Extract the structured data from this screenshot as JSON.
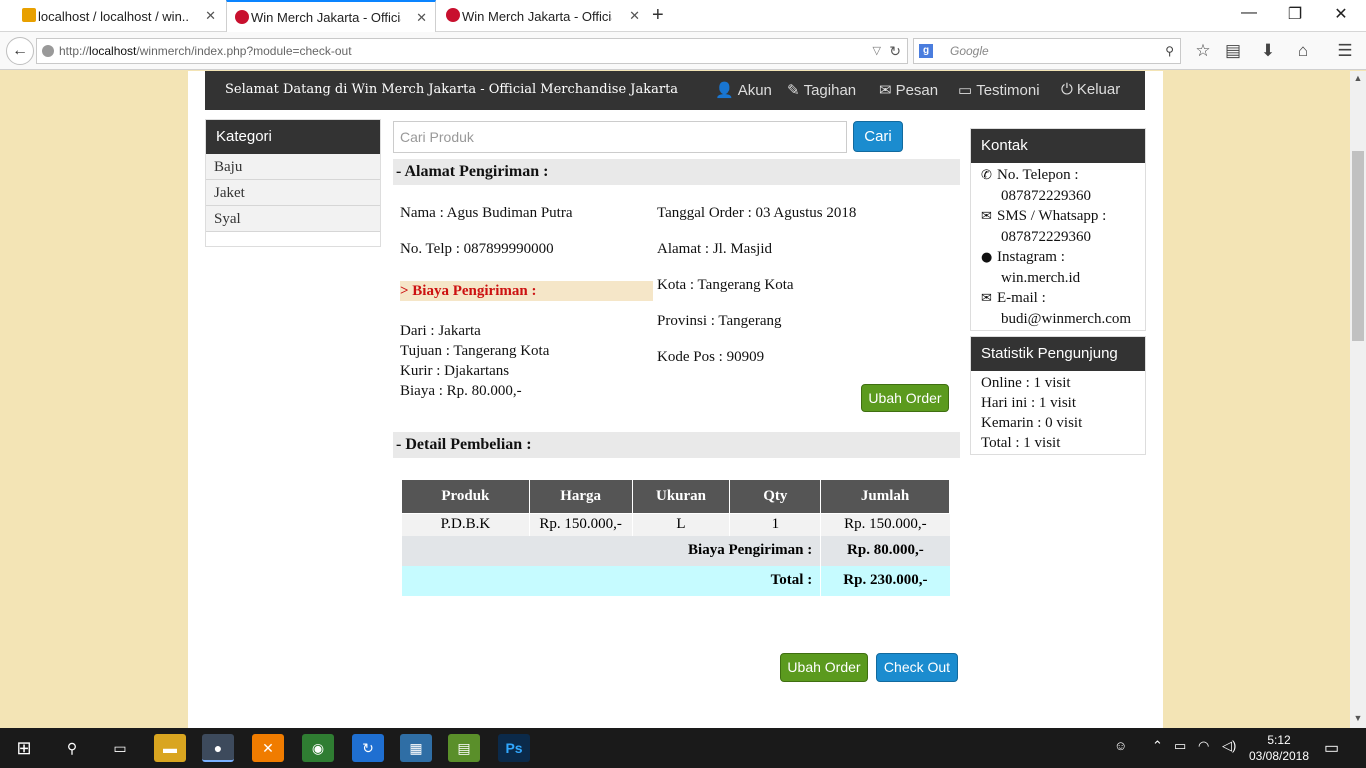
{
  "browser": {
    "tabs": [
      {
        "label": "localhost / localhost / win...",
        "active": false
      },
      {
        "label": "Win Merch Jakarta - Officia...",
        "active": true
      },
      {
        "label": "Win Merch Jakarta - Officia...",
        "active": false
      }
    ],
    "url_prefix": "http://",
    "url_host": "localhost",
    "url_path": "/winmerch/index.php?module=check-out",
    "search_placeholder": "Google"
  },
  "header": {
    "welcome": "Selamat Datang di Win Merch Jakarta - Official Merchandise Jakarta",
    "nav": [
      {
        "label": "Akun",
        "icon": "user-icon"
      },
      {
        "label": "Tagihan",
        "icon": "edit-icon"
      },
      {
        "label": "Pesan",
        "icon": "envelope-icon"
      },
      {
        "label": "Testimoni",
        "icon": "comment-icon"
      },
      {
        "label": "Keluar",
        "icon": "power-icon"
      }
    ]
  },
  "kategori": {
    "title": "Kategori",
    "items": [
      "Baju",
      "Jaket",
      "Syal"
    ]
  },
  "search": {
    "placeholder": "Cari Produk",
    "button": "Cari"
  },
  "alamat": {
    "title": "- Alamat Pengiriman :",
    "nama": "Nama : Agus Budiman Putra",
    "telp": "No. Telp : 087899990000",
    "tanggal": "Tanggal Order : 03 Agustus 2018",
    "alamat": "Alamat : Jl. Masjid",
    "kota": "Kota : Tangerang Kota",
    "provinsi": "Provinsi : Tangerang",
    "kodepos": "Kode Pos : 90909",
    "ubah_label": "Ubah Order"
  },
  "biaya": {
    "title": "> Biaya Pengiriman :",
    "dari": "Dari : Jakarta",
    "tujuan": "Tujuan : Tangerang Kota",
    "kurir": "Kurir : Djakartans",
    "biaya": "Biaya : Rp. 80.000,-"
  },
  "detail": {
    "title": "- Detail Pembelian :",
    "columns": [
      "Produk",
      "Harga",
      "Ukuran",
      "Qty",
      "Jumlah"
    ],
    "row": {
      "produk": "P.D.B.K",
      "harga": "Rp. 150.000,-",
      "ukuran": "L",
      "qty": "1",
      "jumlah": "Rp. 150.000,-"
    },
    "ship_label": "Biaya Pengiriman :",
    "ship_value": "Rp. 80.000,-",
    "total_label": "Total :",
    "total_value": "Rp. 230.000,-"
  },
  "actions": {
    "ubah_label": "Ubah Order",
    "checkout_label": "Check Out"
  },
  "kontak": {
    "title": "Kontak",
    "telepon_label": "No. Telepon :",
    "telepon": "087872229360",
    "sms_label": "SMS / Whatsapp :",
    "sms": "087872229360",
    "instagram_label": "Instagram :",
    "instagram": "win.merch.id",
    "email_label": "E-mail :",
    "email": "budi@winmerch.com"
  },
  "statistik": {
    "title": "Statistik Pengunjung",
    "online": "Online : 1 visit",
    "hari_ini": "Hari ini : 1 visit",
    "kemarin": "Kemarin : 0 visit",
    "total": "Total : 1 visit"
  },
  "taskbar": {
    "time": "5:12",
    "date": "03/08/2018"
  },
  "colors": {
    "nav_dark": "#333333",
    "accent_blue": "#1b8ccf",
    "accent_green": "#5b9a1e",
    "total_row": "#c6fbff",
    "biaya_heading": "#cc1111"
  }
}
